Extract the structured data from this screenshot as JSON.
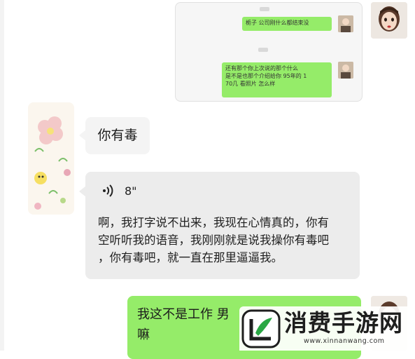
{
  "embedded": {
    "msg1": "栀子 公司刚什么都结束没",
    "msg2": "还有那个你上次说的那个什么\n是不是也那个介绍给你 95年的 1\n70几 看照片 怎么样"
  },
  "messages": [
    {
      "side": "left",
      "text": "你有毒"
    },
    {
      "side": "left",
      "voice_duration": "8\"",
      "transcript": "啊，我打字说不出来，我现在心情真的，你有\n空听听我的语音，我刚刚就是说我操你有毒吧\n，你有毒吧，就一直在那里逼逼我。"
    },
    {
      "side": "right",
      "text": "我这不是工作 男\n嘛"
    }
  ],
  "watermark": {
    "title": "消费手游网",
    "url": "www.xinnanwang.com"
  },
  "colors": {
    "green_bubble": "#95ec69",
    "gray_bubble": "#ececec",
    "logo_green": "#2aa744"
  }
}
